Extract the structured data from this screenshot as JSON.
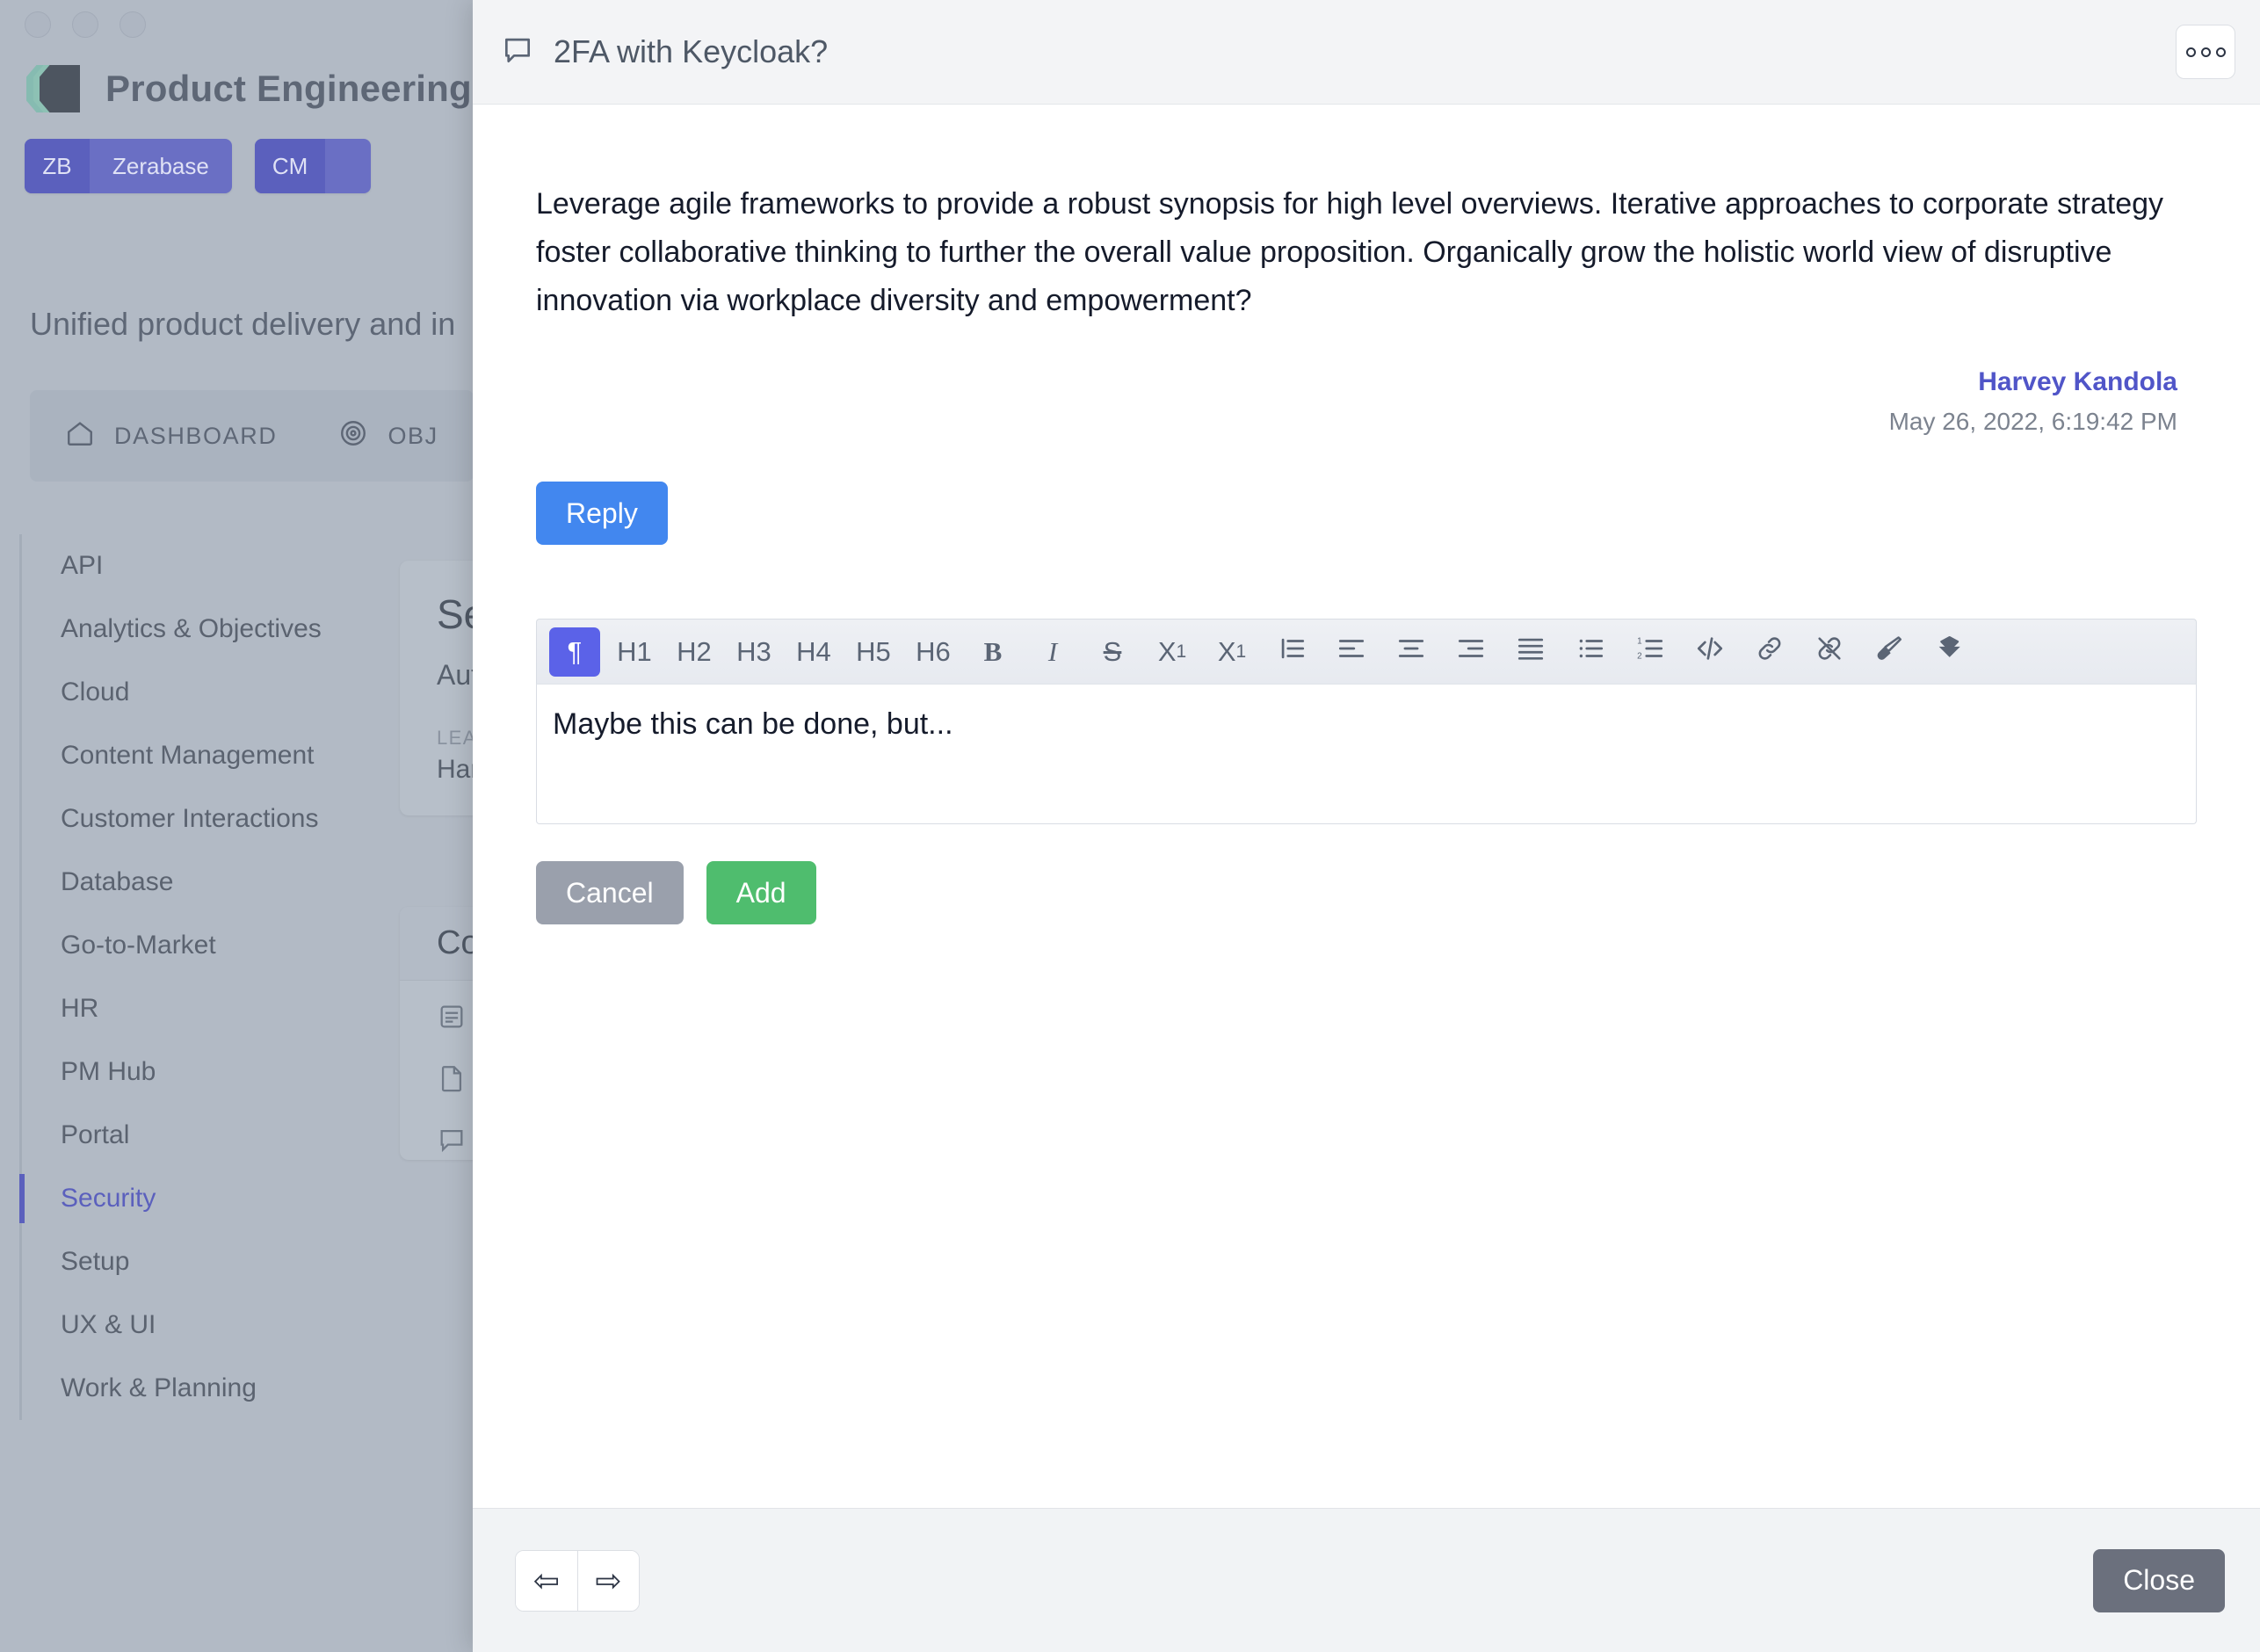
{
  "background_app": {
    "window_controls": [
      "close",
      "minimize",
      "maximize"
    ],
    "brand_title": "Product Engineering Hub",
    "tagline": "Unified product delivery and in",
    "spaces": [
      {
        "key": "ZB",
        "name": "Zerabase"
      },
      {
        "key": "CM",
        "name": ""
      }
    ],
    "nav_tabs": [
      {
        "icon": "home-icon",
        "label": "DASHBOARD"
      },
      {
        "icon": "target-icon",
        "label": "OBJ"
      }
    ],
    "sidebar": {
      "items": [
        {
          "label": "API",
          "active": false
        },
        {
          "label": "Analytics & Objectives",
          "active": false
        },
        {
          "label": "Cloud",
          "active": false
        },
        {
          "label": "Content Management",
          "active": false
        },
        {
          "label": "Customer Interactions",
          "active": false
        },
        {
          "label": "Database",
          "active": false
        },
        {
          "label": "Go-to-Market",
          "active": false
        },
        {
          "label": "HR",
          "active": false
        },
        {
          "label": "PM Hub",
          "active": false
        },
        {
          "label": "Portal",
          "active": false
        },
        {
          "label": "Security",
          "active": true
        },
        {
          "label": "Setup",
          "active": false
        },
        {
          "label": "UX & UI",
          "active": false
        },
        {
          "label": "Work & Planning",
          "active": false
        }
      ]
    },
    "cards": {
      "detail_card": {
        "title": "Se",
        "subtitle": "Aut",
        "label": "LEA",
        "value": "Har"
      },
      "contents_card": {
        "title": "Con",
        "rows": [
          {
            "icon": "article-icon",
            "label": ""
          },
          {
            "icon": "page-icon",
            "label": ""
          },
          {
            "icon": "comment-icon",
            "label": ""
          }
        ]
      }
    }
  },
  "modal": {
    "header": {
      "icon": "comment-icon",
      "title": "2FA with Keycloak?",
      "more_button": "more-icon"
    },
    "comment": {
      "body": "Leverage agile frameworks to provide a robust synopsis for high level overviews. Iterative approaches to corporate strategy foster collaborative thinking to further the overall value proposition. Organically grow the holistic world view of disruptive innovation via workplace diversity and empowerment?",
      "author": "Harvey Kandola",
      "date": "May 26, 2022, 6:19:42 PM",
      "reply_label": "Reply"
    },
    "editor": {
      "value": "Maybe this can be done, but...",
      "toolbar": [
        {
          "name": "paragraph",
          "glyph": "¶",
          "active": true
        },
        {
          "name": "heading-1",
          "glyph": "H1",
          "active": false
        },
        {
          "name": "heading-2",
          "glyph": "H2",
          "active": false
        },
        {
          "name": "heading-3",
          "glyph": "H3",
          "active": false
        },
        {
          "name": "heading-4",
          "glyph": "H4",
          "active": false
        },
        {
          "name": "heading-5",
          "glyph": "H5",
          "active": false
        },
        {
          "name": "heading-6",
          "glyph": "H6",
          "active": false
        },
        {
          "name": "bold",
          "glyph": "B",
          "active": false
        },
        {
          "name": "italic",
          "glyph": "I",
          "active": false
        },
        {
          "name": "strikethrough",
          "glyph": "S",
          "active": false
        },
        {
          "name": "superscript",
          "glyph": "X",
          "active": false
        },
        {
          "name": "subscript",
          "glyph": "X",
          "active": false
        },
        {
          "name": "indent",
          "glyph": "",
          "active": false
        },
        {
          "name": "align-left",
          "glyph": "",
          "active": false
        },
        {
          "name": "align-center",
          "glyph": "",
          "active": false
        },
        {
          "name": "align-right",
          "glyph": "",
          "active": false
        },
        {
          "name": "align-justify",
          "glyph": "",
          "active": false
        },
        {
          "name": "bullet-list",
          "glyph": "",
          "active": false
        },
        {
          "name": "numbered-list",
          "glyph": "",
          "active": false
        },
        {
          "name": "code",
          "glyph": "",
          "active": false
        },
        {
          "name": "link",
          "glyph": "",
          "active": false
        },
        {
          "name": "unlink",
          "glyph": "",
          "active": false
        },
        {
          "name": "text-color",
          "glyph": "",
          "active": false
        },
        {
          "name": "highlight",
          "glyph": "",
          "active": false
        }
      ],
      "cancel_label": "Cancel",
      "add_label": "Add"
    },
    "footer": {
      "prev_glyph": "⇦",
      "next_glyph": "⇨",
      "close_label": "Close"
    }
  },
  "colors": {
    "accent_indigo": "#5b60bd",
    "toolbar_active": "#5b62e8",
    "reply_blue": "#4287ef",
    "add_green": "#4fbd6e",
    "cancel_gray": "#9aa0ac",
    "close_gray": "#6b707d",
    "backdrop": "#b2bac5"
  }
}
